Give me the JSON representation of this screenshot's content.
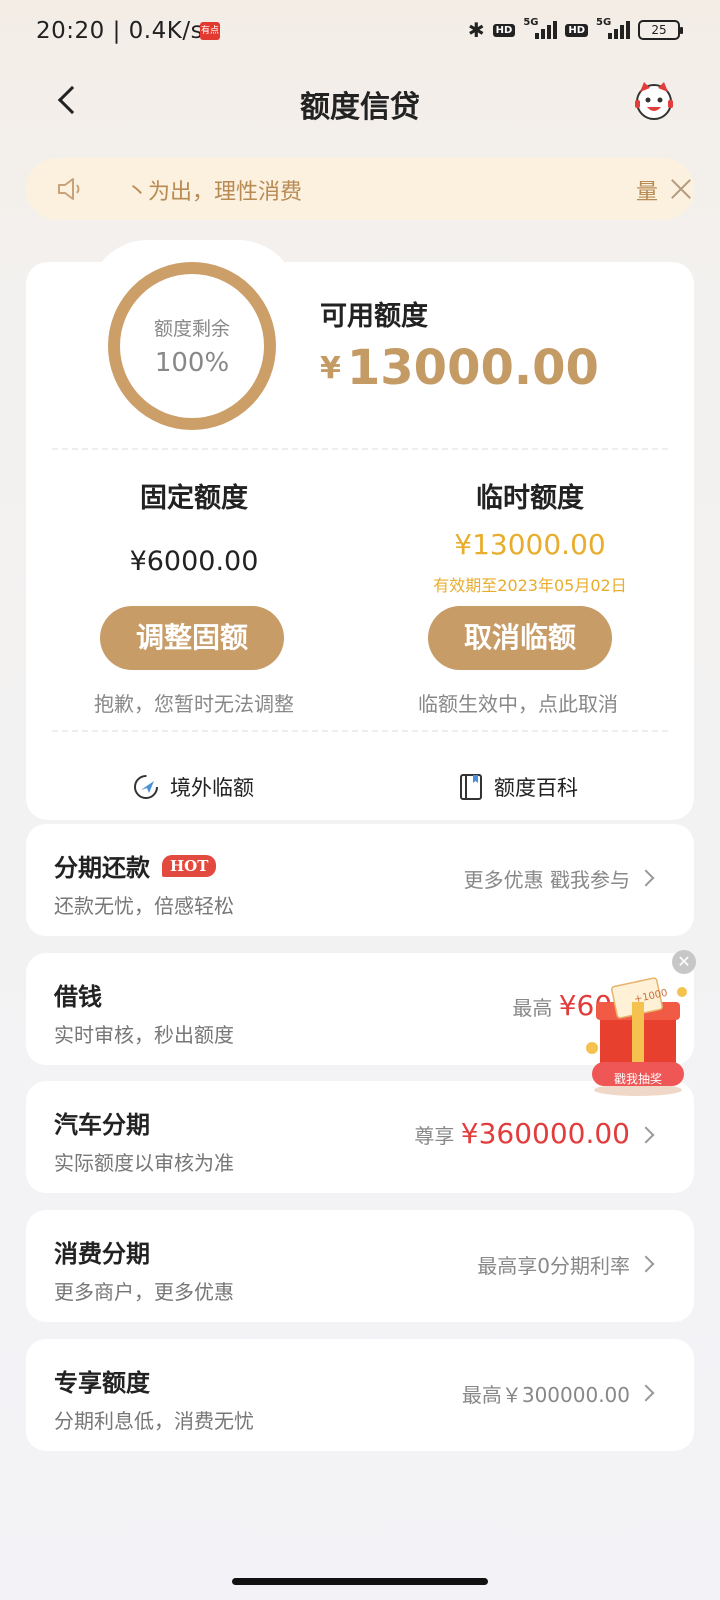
{
  "status_bar": {
    "time": "20:20 | 0.4K/s",
    "app_icon_text": "有点",
    "hd1": "HD",
    "net1": "5G",
    "hd2": "HD",
    "net2": "5G",
    "battery": "25"
  },
  "nav": {
    "title": "额度信贷"
  },
  "notice": {
    "text": "丶为出，理性消费",
    "mid_text": "量"
  },
  "credit": {
    "ring_label": "额度剩余",
    "ring_value": "100%",
    "ring_fraction": 1.0,
    "available_label": "可用额度",
    "available_currency": "¥",
    "available_amount": "13000.00",
    "fixed": {
      "title": "固定额度",
      "amount": "¥6000.00",
      "button": "调整固额",
      "note": "抱歉，您暂时无法调整"
    },
    "temp": {
      "title": "临时额度",
      "amount": "¥13000.00",
      "valid": "有效期至2023年05月02日",
      "button": "取消临额",
      "note": "临额生效中，点此取消"
    },
    "links": {
      "overseas": "境外临额",
      "wiki": "额度百科"
    }
  },
  "list": [
    {
      "title": "分期还款",
      "badge": "HOT",
      "sub": "还款无忧，倍感轻松",
      "right_prefix": "更多优惠 戳我参与",
      "right_red": ""
    },
    {
      "title": "借钱",
      "badge": "",
      "sub": "实时审核，秒出额度",
      "right_prefix": "最高 ",
      "right_red": "¥600"
    },
    {
      "title": "汽车分期",
      "badge": "",
      "sub": "实际额度以审核为准",
      "right_prefix": "尊享 ",
      "right_red": "¥360000.00"
    },
    {
      "title": "消费分期",
      "badge": "",
      "sub": "更多商户，更多优惠",
      "right_prefix": "最高享0分期利率",
      "right_red": ""
    },
    {
      "title": "专享额度",
      "badge": "",
      "sub": "分期利息低，消费无忧",
      "right_prefix": "最高￥300000.00",
      "right_red": ""
    }
  ],
  "promo": {
    "label": "戳我抽奖",
    "tag": "+1000"
  },
  "colors": {
    "gold": "#c79c67",
    "temp_gold": "#e9ad2d",
    "red": "#e23c3c",
    "notice_bg": "#fbf1de"
  }
}
